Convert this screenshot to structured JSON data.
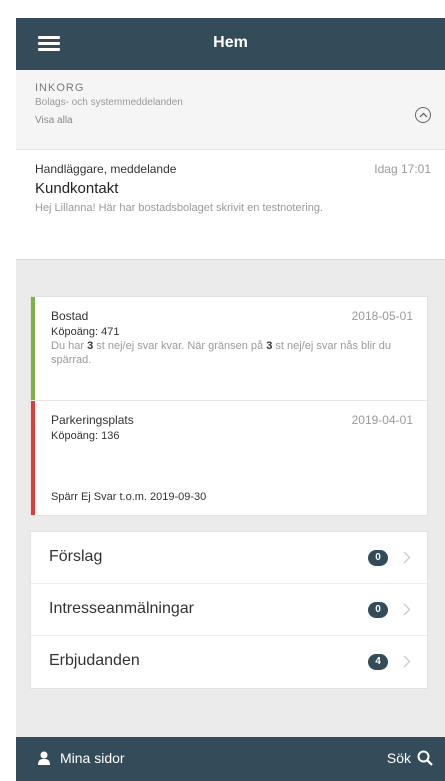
{
  "header": {
    "title": "Hem",
    "menu_icon": "hamburger-icon"
  },
  "inbox": {
    "title": "INKORG",
    "subtitle": "Bolags- och systemmeddelanden",
    "show_all": "Visa alla",
    "collapse_icon": "chevron-up-circle-icon"
  },
  "message": {
    "sender": "Handläggare, meddelande",
    "time": "Idag 17:01",
    "subject": "Kundkontakt",
    "body": "Hej Lillanna! Här har bostadsbolaget skrivit en testnotering."
  },
  "status": {
    "items": [
      {
        "title": "Bostad",
        "date": "2018-05-01",
        "points": "Köpoäng: 471",
        "note_pre": "Du har ",
        "note_count": "3",
        "note_mid": " st nej/ej svar kvar. När gränsen på ",
        "note_limit": "3",
        "note_post": " st nej/ej svar nås blir du spärrad.",
        "accent_color": "#7cb342"
      },
      {
        "title": "Parkeringsplats",
        "date": "2019-04-01",
        "points": "Köpoäng: 136",
        "block": "Spärr Ej Svar t.o.m. 2019-09-30",
        "accent_color": "#e53935"
      }
    ]
  },
  "nav": {
    "items": [
      {
        "label": "Förslag",
        "count": "0"
      },
      {
        "label": "Intresseanmälningar",
        "count": "0"
      },
      {
        "label": "Erbjudanden",
        "count": "4"
      }
    ],
    "chevron_icon": "chevron-right-icon"
  },
  "footer": {
    "my_pages": "Mina sidor",
    "my_pages_icon": "user-icon",
    "search": "Sök",
    "search_icon": "search-icon"
  },
  "colors": {
    "primary": "#344c5a",
    "background": "#ebebeb"
  }
}
